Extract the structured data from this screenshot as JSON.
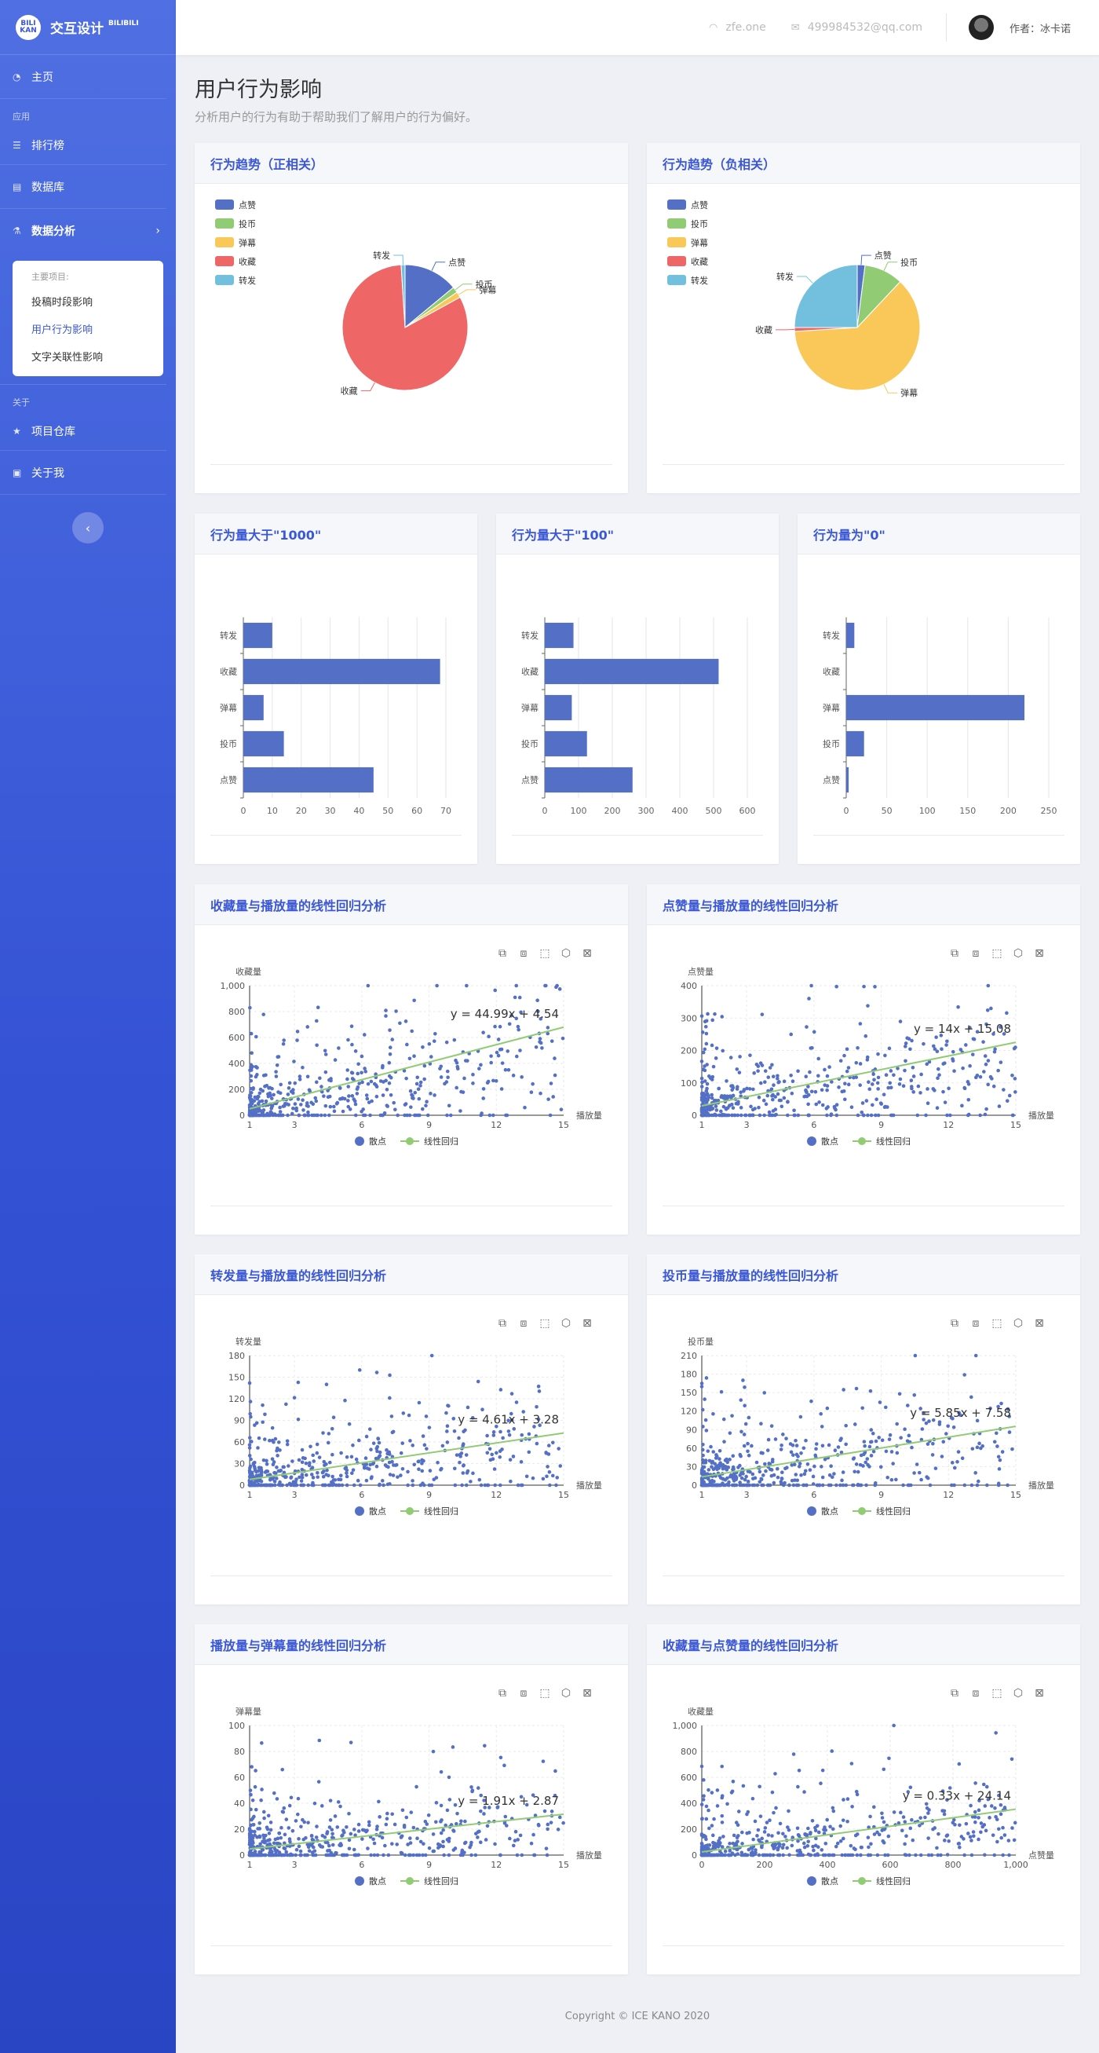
{
  "brand": {
    "logo": "BILI KAN",
    "title": "交互设计",
    "subtitle": "BILIBILI"
  },
  "sidebar": {
    "home": "主页",
    "section_app": "应用",
    "rank": "排行榜",
    "database": "数据库",
    "analysis": "数据分析",
    "submenu_caption": "主要项目:",
    "submenu": [
      "投稿时段影响",
      "用户行为影响",
      "文字关联性影响"
    ],
    "section_about": "关于",
    "repo": "项目仓库",
    "about_me": "关于我"
  },
  "header": {
    "site": "zfe.one",
    "email": "499984532@qq.com",
    "author": "作者：冰卡诺"
  },
  "page": {
    "title": "用户行为影响",
    "desc": "分析用户的行为有助于帮助我们了解用户的行为偏好。"
  },
  "card_titles": {
    "pie_pos": "行为趋势（正相关）",
    "pie_neg": "行为趋势（负相关）",
    "bar_1000": "行为量大于\"1000\"",
    "bar_100": "行为量大于\"100\"",
    "bar_0": "行为量为\"0\"",
    "sc1": "收藏量与播放量的线性回归分析",
    "sc2": "点赞量与播放量的线性回归分析",
    "sc3": "转发量与播放量的线性回归分析",
    "sc4": "投币量与播放量的线性回归分析",
    "sc5": "播放量与弹幕量的线性回归分析",
    "sc6": "收藏量与点赞量的线性回归分析"
  },
  "legend": {
    "scatter": "散点",
    "regression": "线性回归"
  },
  "footer": "Copyright © ICE KANO 2020",
  "colors": {
    "blue": "#5470c6",
    "green": "#91cc75",
    "yellow": "#fac858",
    "red": "#ee6666",
    "cyan": "#73c0de"
  },
  "chart_data": [
    {
      "type": "pie",
      "id": "pie_pos",
      "labels": [
        "点赞",
        "投币",
        "弹幕",
        "收藏",
        "转发"
      ],
      "values": [
        14,
        1.5,
        1.5,
        82,
        1
      ]
    },
    {
      "type": "pie",
      "id": "pie_neg",
      "labels": [
        "点赞",
        "投币",
        "弹幕",
        "收藏",
        "转发"
      ],
      "values": [
        2,
        10,
        62,
        1,
        25
      ]
    },
    {
      "type": "bar",
      "id": "bar_1000",
      "orientation": "horizontal",
      "categories": [
        "点赞",
        "投币",
        "弹幕",
        "收藏",
        "转发"
      ],
      "values": [
        45,
        14,
        7,
        68,
        10
      ],
      "xlim": [
        0,
        70
      ],
      "ticks": [
        0,
        10,
        20,
        30,
        40,
        50,
        60,
        70
      ]
    },
    {
      "type": "bar",
      "id": "bar_100",
      "orientation": "horizontal",
      "categories": [
        "点赞",
        "投币",
        "弹幕",
        "收藏",
        "转发"
      ],
      "values": [
        260,
        125,
        80,
        515,
        85
      ],
      "xlim": [
        0,
        600
      ],
      "ticks": [
        0,
        100,
        200,
        300,
        400,
        500,
        600
      ]
    },
    {
      "type": "bar",
      "id": "bar_0",
      "orientation": "horizontal",
      "categories": [
        "点赞",
        "投币",
        "弹幕",
        "收藏",
        "转发"
      ],
      "values": [
        3,
        22,
        220,
        0,
        10
      ],
      "xlim": [
        0,
        250
      ],
      "ticks": [
        0,
        50,
        100,
        150,
        200,
        250
      ]
    },
    {
      "type": "scatter",
      "id": "sc1",
      "ylabel": "收藏量",
      "xlabel": "播放量",
      "xticks": [
        1,
        3,
        6,
        9,
        12,
        15
      ],
      "xlim": [
        1,
        15
      ],
      "yticks": [
        0,
        200,
        400,
        600,
        800,
        1000
      ],
      "ylim": [
        0,
        1000
      ],
      "ytick_labels": [
        "0",
        "200",
        "400",
        "600",
        "800",
        "1,000"
      ],
      "equation": "y = 44.99x + 4.54",
      "slope": 44.99,
      "intercept": 4.54,
      "n": 520
    },
    {
      "type": "scatter",
      "id": "sc2",
      "ylabel": "点赞量",
      "xlabel": "播放量",
      "xticks": [
        1,
        3,
        6,
        9,
        12,
        15
      ],
      "xlim": [
        1,
        15
      ],
      "yticks": [
        0,
        100,
        200,
        300,
        400
      ],
      "ylim": [
        0,
        400
      ],
      "ytick_labels": [
        "0",
        "100",
        "200",
        "300",
        "400"
      ],
      "equation": "y = 14x + 15.08",
      "slope": 14,
      "intercept": 15.08,
      "n": 520
    },
    {
      "type": "scatter",
      "id": "sc3",
      "ylabel": "转发量",
      "xlabel": "播放量",
      "xticks": [
        1,
        3,
        6,
        9,
        12,
        15
      ],
      "xlim": [
        1,
        15
      ],
      "yticks": [
        0,
        30,
        60,
        90,
        120,
        150,
        180
      ],
      "ylim": [
        0,
        180
      ],
      "ytick_labels": [
        "0",
        "30",
        "60",
        "90",
        "120",
        "150",
        "180"
      ],
      "equation": "y = 4.61x + 3.28",
      "slope": 4.61,
      "intercept": 3.28,
      "n": 520
    },
    {
      "type": "scatter",
      "id": "sc4",
      "ylabel": "投币量",
      "xlabel": "播放量",
      "xticks": [
        1,
        3,
        6,
        9,
        12,
        15
      ],
      "xlim": [
        1,
        15
      ],
      "yticks": [
        0,
        30,
        60,
        90,
        120,
        150,
        180,
        210
      ],
      "ylim": [
        0,
        210
      ],
      "ytick_labels": [
        "0",
        "30",
        "60",
        "90",
        "120",
        "150",
        "180",
        "210"
      ],
      "equation": "y = 5.85x + 7.58",
      "slope": 5.85,
      "intercept": 7.58,
      "n": 520
    },
    {
      "type": "scatter",
      "id": "sc5",
      "ylabel": "弹幕量",
      "xlabel": "播放量",
      "xticks": [
        1,
        3,
        6,
        9,
        12,
        15
      ],
      "xlim": [
        1,
        15
      ],
      "yticks": [
        0,
        20,
        40,
        60,
        80,
        100
      ],
      "ylim": [
        0,
        100
      ],
      "ytick_labels": [
        "0",
        "20",
        "40",
        "60",
        "80",
        "100"
      ],
      "equation": "y = 1.91x + 2.87",
      "slope": 1.91,
      "intercept": 2.87,
      "n": 520
    },
    {
      "type": "scatter",
      "id": "sc6",
      "ylabel": "收藏量",
      "xlabel": "点赞量",
      "xticks": [
        0,
        200,
        400,
        600,
        800,
        1000
      ],
      "xlim": [
        0,
        1000
      ],
      "xtick_labels": [
        "0",
        "200",
        "400",
        "600",
        "800",
        "1,000"
      ],
      "yticks": [
        0,
        200,
        400,
        600,
        800,
        1000
      ],
      "ylim": [
        0,
        1000
      ],
      "ytick_labels": [
        "0",
        "200",
        "400",
        "600",
        "800",
        "1,000"
      ],
      "equation": "y = 0.33x + 24.14",
      "slope": 0.33,
      "intercept": 24.14,
      "n": 520
    }
  ]
}
